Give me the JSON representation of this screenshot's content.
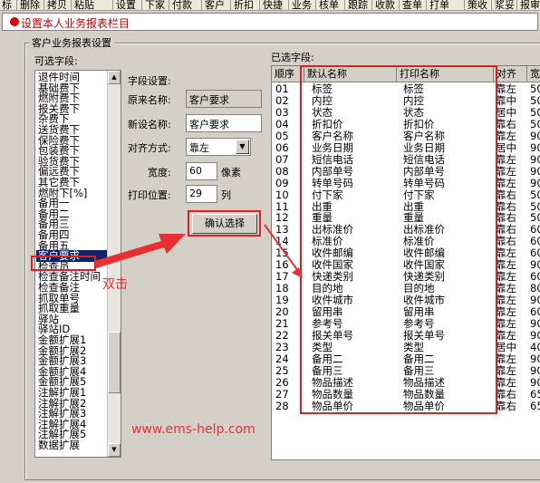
{
  "toolbar": {
    "items": [
      "标",
      "删除",
      "拷贝",
      "粘贴",
      "设置",
      "下家",
      "付款",
      "客户",
      "折扣",
      "快捷",
      "业务",
      "核单",
      "跟踪",
      "收款",
      "查单",
      "打单",
      "策收",
      "浆妥",
      "报审"
    ]
  },
  "title": "设置本人业务报表栏目",
  "group_title": "客户业务报表设置",
  "available": {
    "label": "可选字段:",
    "items": [
      "退件时间",
      "基础费下",
      "燃附费下",
      "报关费下",
      "杂费下",
      "送货费下",
      "保险费下",
      "包装费下",
      "验货费下",
      "偏远费下",
      "其它费下",
      "燃附下[%]",
      "备用一",
      "备用二",
      "备用三",
      "备用四",
      "备用五",
      "客户要求",
      "检查员",
      "检查备注时间",
      "检查备注",
      "抓取单号",
      "抓取重量",
      "驿站",
      "驿站ID",
      "金额扩展1",
      "金额扩展2",
      "金额扩展3",
      "金额扩展4",
      "金额扩展5",
      "注解扩展1",
      "注解扩展2",
      "注解扩展3",
      "注解扩展4",
      "注解扩展5",
      "数据扩展"
    ],
    "selected_index": 17,
    "scroll_up": "▲",
    "scroll_down": "▼"
  },
  "settings": {
    "heading": "字段设置:",
    "original_label": "原来名称:",
    "original_value": "客户要求",
    "newname_label": "新设名称:",
    "newname_value": "客户要求",
    "align_label": "对齐方式:",
    "align_value": "靠左",
    "width_label": "宽度:",
    "width_value": "60",
    "width_unit": "像素",
    "pos_label": "打印位置:",
    "pos_value": "29",
    "pos_unit": "列",
    "confirm": "确认选择"
  },
  "selected": {
    "label": "已选字段:",
    "headers": [
      "顺序",
      "默认名称",
      "打印名称",
      "对齐",
      "宽"
    ],
    "rows": [
      [
        "01",
        "标签",
        "标签",
        "靠左",
        "50"
      ],
      [
        "02",
        "内控",
        "内控",
        "靠中",
        "50"
      ],
      [
        "03",
        "状态",
        "状态",
        "居中",
        "50"
      ],
      [
        "04",
        "折扣价",
        "折扣价",
        "靠右",
        "50"
      ],
      [
        "05",
        "客户名称",
        "客户名称",
        "靠左",
        "90"
      ],
      [
        "06",
        "业务日期",
        "业务日期",
        "居中",
        "90"
      ],
      [
        "07",
        "短信电话",
        "短信电话",
        "靠左",
        "90"
      ],
      [
        "08",
        "内部单号",
        "内部单号",
        "靠左",
        "90"
      ],
      [
        "09",
        "转单号码",
        "转单号码",
        "靠左",
        "90"
      ],
      [
        "10",
        "付下家",
        "付下家",
        "靠右",
        "50"
      ],
      [
        "11",
        "出重",
        "出重",
        "靠右",
        "50"
      ],
      [
        "12",
        "重量",
        "重量",
        "靠右",
        "50"
      ],
      [
        "13",
        "出标准价",
        "出标准价",
        "靠右",
        "60"
      ],
      [
        "14",
        "标准价",
        "标准价",
        "靠右",
        "60"
      ],
      [
        "15",
        "收件邮编",
        "收件邮编",
        "靠左",
        "60"
      ],
      [
        "16",
        "收件国家",
        "收件国家",
        "靠左",
        "90"
      ],
      [
        "17",
        "快递类别",
        "快递类别",
        "靠左",
        "60"
      ],
      [
        "18",
        "目的地",
        "目的地",
        "靠左",
        "80"
      ],
      [
        "19",
        "收件城市",
        "收件城市",
        "靠左",
        "90"
      ],
      [
        "20",
        "留用串",
        "留用串",
        "靠左",
        "60"
      ],
      [
        "21",
        "参考号",
        "参考号",
        "靠左",
        "90"
      ],
      [
        "22",
        "报关单号",
        "报关单号",
        "靠左",
        "90"
      ],
      [
        "23",
        "类型",
        "类型",
        "居中",
        "40"
      ],
      [
        "24",
        "备用二",
        "备用二",
        "靠左",
        "90"
      ],
      [
        "25",
        "备用三",
        "备用三",
        "靠左",
        "90"
      ],
      [
        "26",
        "物品描述",
        "物品描述",
        "靠左",
        "90"
      ],
      [
        "27",
        "物品数量",
        "物品数量",
        "靠右",
        "65"
      ],
      [
        "28",
        "物品单价",
        "物品单价",
        "靠右",
        "65"
      ]
    ]
  },
  "annotations": {
    "double_click": "双击",
    "watermark": "www.ems-help.com"
  },
  "colors": {
    "annotation_red": "#e02020",
    "title_red": "#c00000",
    "selection_blue": "#0a246a"
  }
}
